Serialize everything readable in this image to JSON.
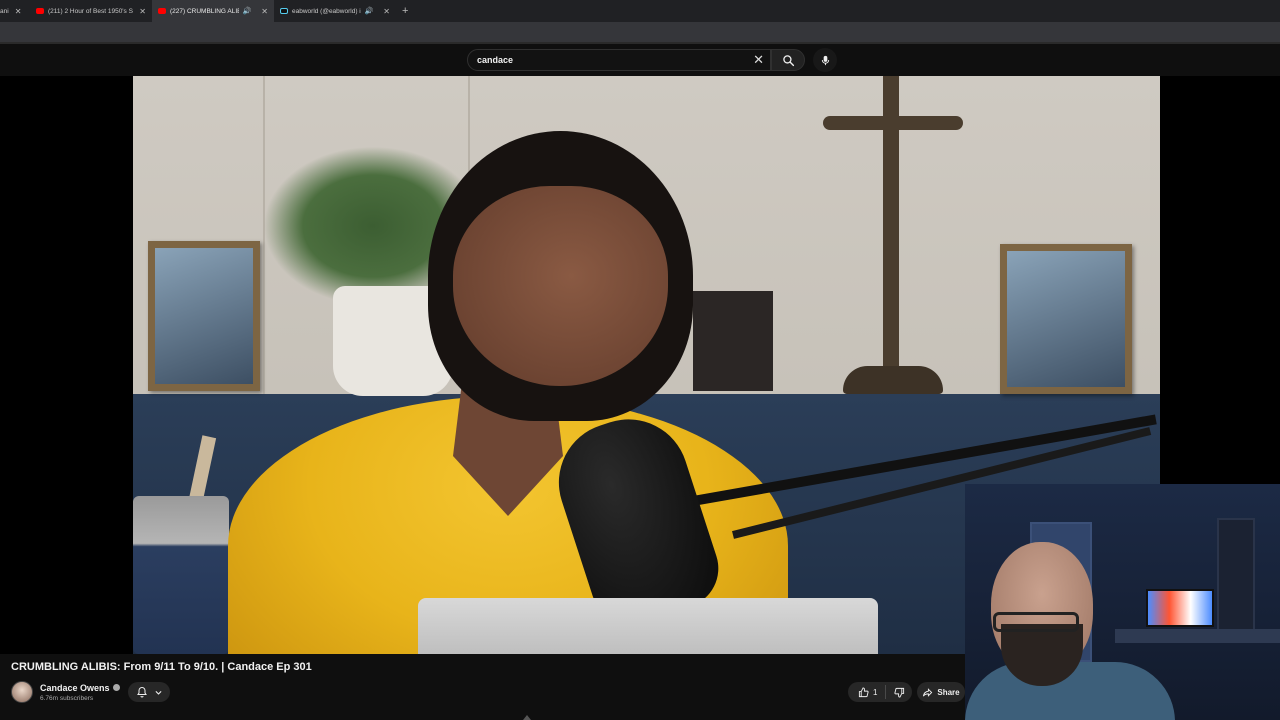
{
  "browser": {
    "tabs": [
      {
        "label": "ani",
        "favicon": "generic-icon",
        "active": false
      },
      {
        "label": "(211) 2 Hour of Best 1950's So",
        "favicon": "youtube-icon",
        "active": false
      },
      {
        "label": "(227) CRUMBLING ALIBIS: F",
        "favicon": "youtube-icon",
        "active": true,
        "audio": true
      },
      {
        "label": "eabworld (@eabworld) is LI",
        "favicon": "tiktok-icon",
        "active": false,
        "audio": true
      }
    ],
    "new_tab_label": "+"
  },
  "search": {
    "value": "candace",
    "clear_label": "✕"
  },
  "video": {
    "title": "CRUMBLING ALIBIS: From 9/11 To 9/10. | Candace Ep 301",
    "channel_name": "Candace Owens",
    "subscribers": "6.76m subscribers",
    "like_count": "1",
    "share_label": "Share"
  },
  "colors": {
    "background": "#0f0f0f",
    "tab_strip": "#202124",
    "active_tab": "#35363a",
    "button_bg": "#272727",
    "youtube_red": "#ff0000"
  }
}
